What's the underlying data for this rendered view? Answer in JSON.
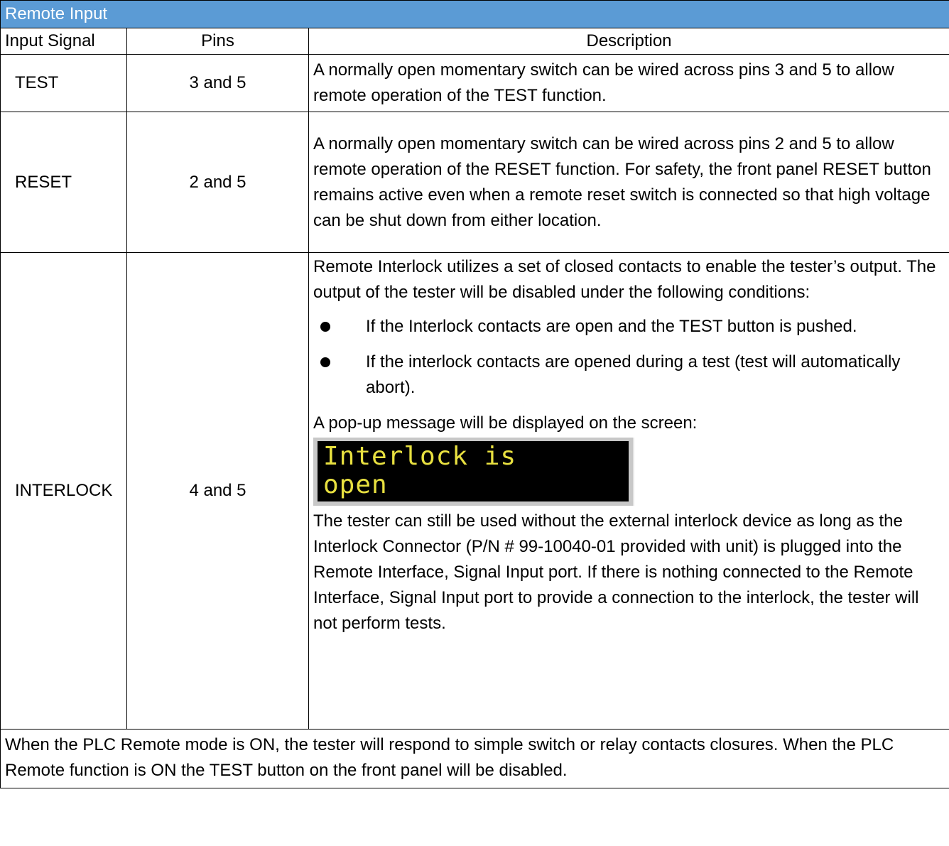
{
  "table": {
    "title": "Remote Input",
    "headers": [
      "Input Signal",
      "Pins",
      "Description"
    ],
    "rows": [
      {
        "signal": "TEST",
        "pins": "3 and 5",
        "description": "A normally open momentary switch can be wired across pins 3 and 5 to allow remote operation of the TEST function."
      },
      {
        "signal": "RESET",
        "pins": "2 and 5",
        "description": "A normally open momentary switch can be wired across pins 2 and 5 to allow remote operation of the RESET function. For safety, the front panel RESET button remains active even when a remote reset switch is connected so that high voltage can be shut down from either location."
      },
      {
        "signal": "INTERLOCK",
        "pins": "4 and 5",
        "intro": "Remote Interlock utilizes a set of closed contacts to enable the tester’s output. The output of the tester will be disabled under the following conditions:",
        "bullets": [
          "If the Interlock contacts are open and the TEST button is pushed.",
          "If the interlock contacts are opened during a test (test will automatically abort)."
        ],
        "popup_intro": "A pop-up message will be displayed on the screen:",
        "lcd_line1": "Interlock is",
        "lcd_line2": "open",
        "closing": "The tester can still be used without the external interlock device as long as the Interlock Connector (P/N # 99-10040-01 provided with unit) is plugged into the Remote Interface, Signal Input port. If there is nothing connected to the Remote Interface, Signal Input port to provide a connection to the interlock, the tester will not perform tests."
      }
    ],
    "footer": "When the PLC Remote mode is ON, the tester will respond to simple switch or relay contacts closures. When the PLC Remote function is ON the TEST button on the front panel will be disabled."
  },
  "colors": {
    "title_bg": "#5b9bd5",
    "title_text": "#ffffff",
    "lcd_bg": "#000000",
    "lcd_text": "#e8e040"
  }
}
